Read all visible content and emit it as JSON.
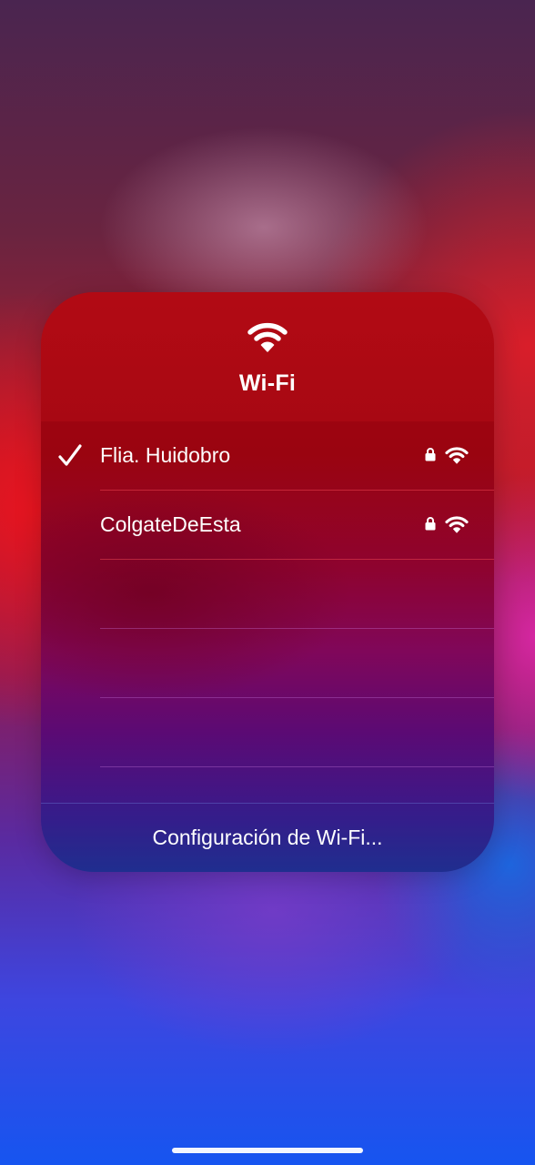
{
  "panel": {
    "title": "Wi-Fi",
    "header_icon": "wifi-icon"
  },
  "networks": [
    {
      "name": "Flia. Huidobro",
      "connected": true,
      "secured": true,
      "signal_bars": 3
    },
    {
      "name": "ColgateDeEsta",
      "connected": false,
      "secured": true,
      "signal_bars": 3
    }
  ],
  "empty_rows": 3,
  "footer": {
    "settings_label": "Configuración de Wi-Fi..."
  }
}
